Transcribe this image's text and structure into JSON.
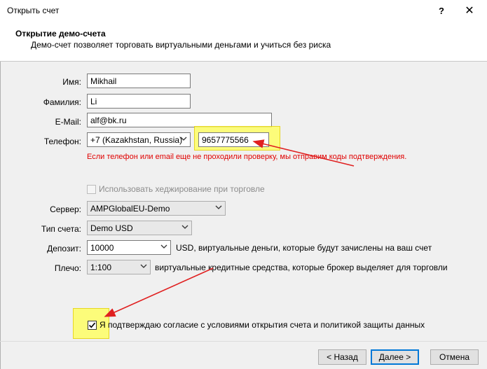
{
  "window": {
    "title": "Открыть счет",
    "help_glyph": "?",
    "close_glyph": "✕"
  },
  "header": {
    "title": "Открытие демо-счета",
    "subtitle": "Демо-счет позволяет торговать виртуальными деньгами и учиться без риска"
  },
  "form": {
    "first_name_label": "Имя:",
    "first_name_value": "Mikhail",
    "last_name_label": "Фамилия:",
    "last_name_value": "Li",
    "email_label": "E-Mail:",
    "email_value": "alf@bk.ru",
    "phone_label": "Телефон:",
    "phone_country": "+7 (Kazakhstan, Russia)",
    "phone_value": "9657775566",
    "phone_warning": "Если телефон или email еще не проходили проверку, мы отправим коды подтверждения.",
    "hedging_label": "Использовать хеджирование при торговле",
    "server_label": "Сервер:",
    "server_value": "AMPGlobalEU-Demo",
    "account_type_label": "Тип счета:",
    "account_type_value": "Demo USD",
    "deposit_label": "Депозит:",
    "deposit_value": "10000",
    "deposit_desc": "USD, виртуальные деньги, которые будут зачислены на ваш счет",
    "leverage_label": "Плечо:",
    "leverage_value": "1:100",
    "leverage_desc": "виртуальные кредитные средства, которые брокер выделяет для торговли",
    "agree_label": "Я подтверждаю согласие с условиями открытия счета и политикой защиты данных",
    "agree_checked": true
  },
  "footer": {
    "back_label": "< Назад",
    "next_label": "Далее >",
    "cancel_label": "Отмена"
  },
  "colors": {
    "warning": "#e00000",
    "highlight": "#ffff66",
    "arrow": "#e02020",
    "accent": "#0078d7"
  }
}
